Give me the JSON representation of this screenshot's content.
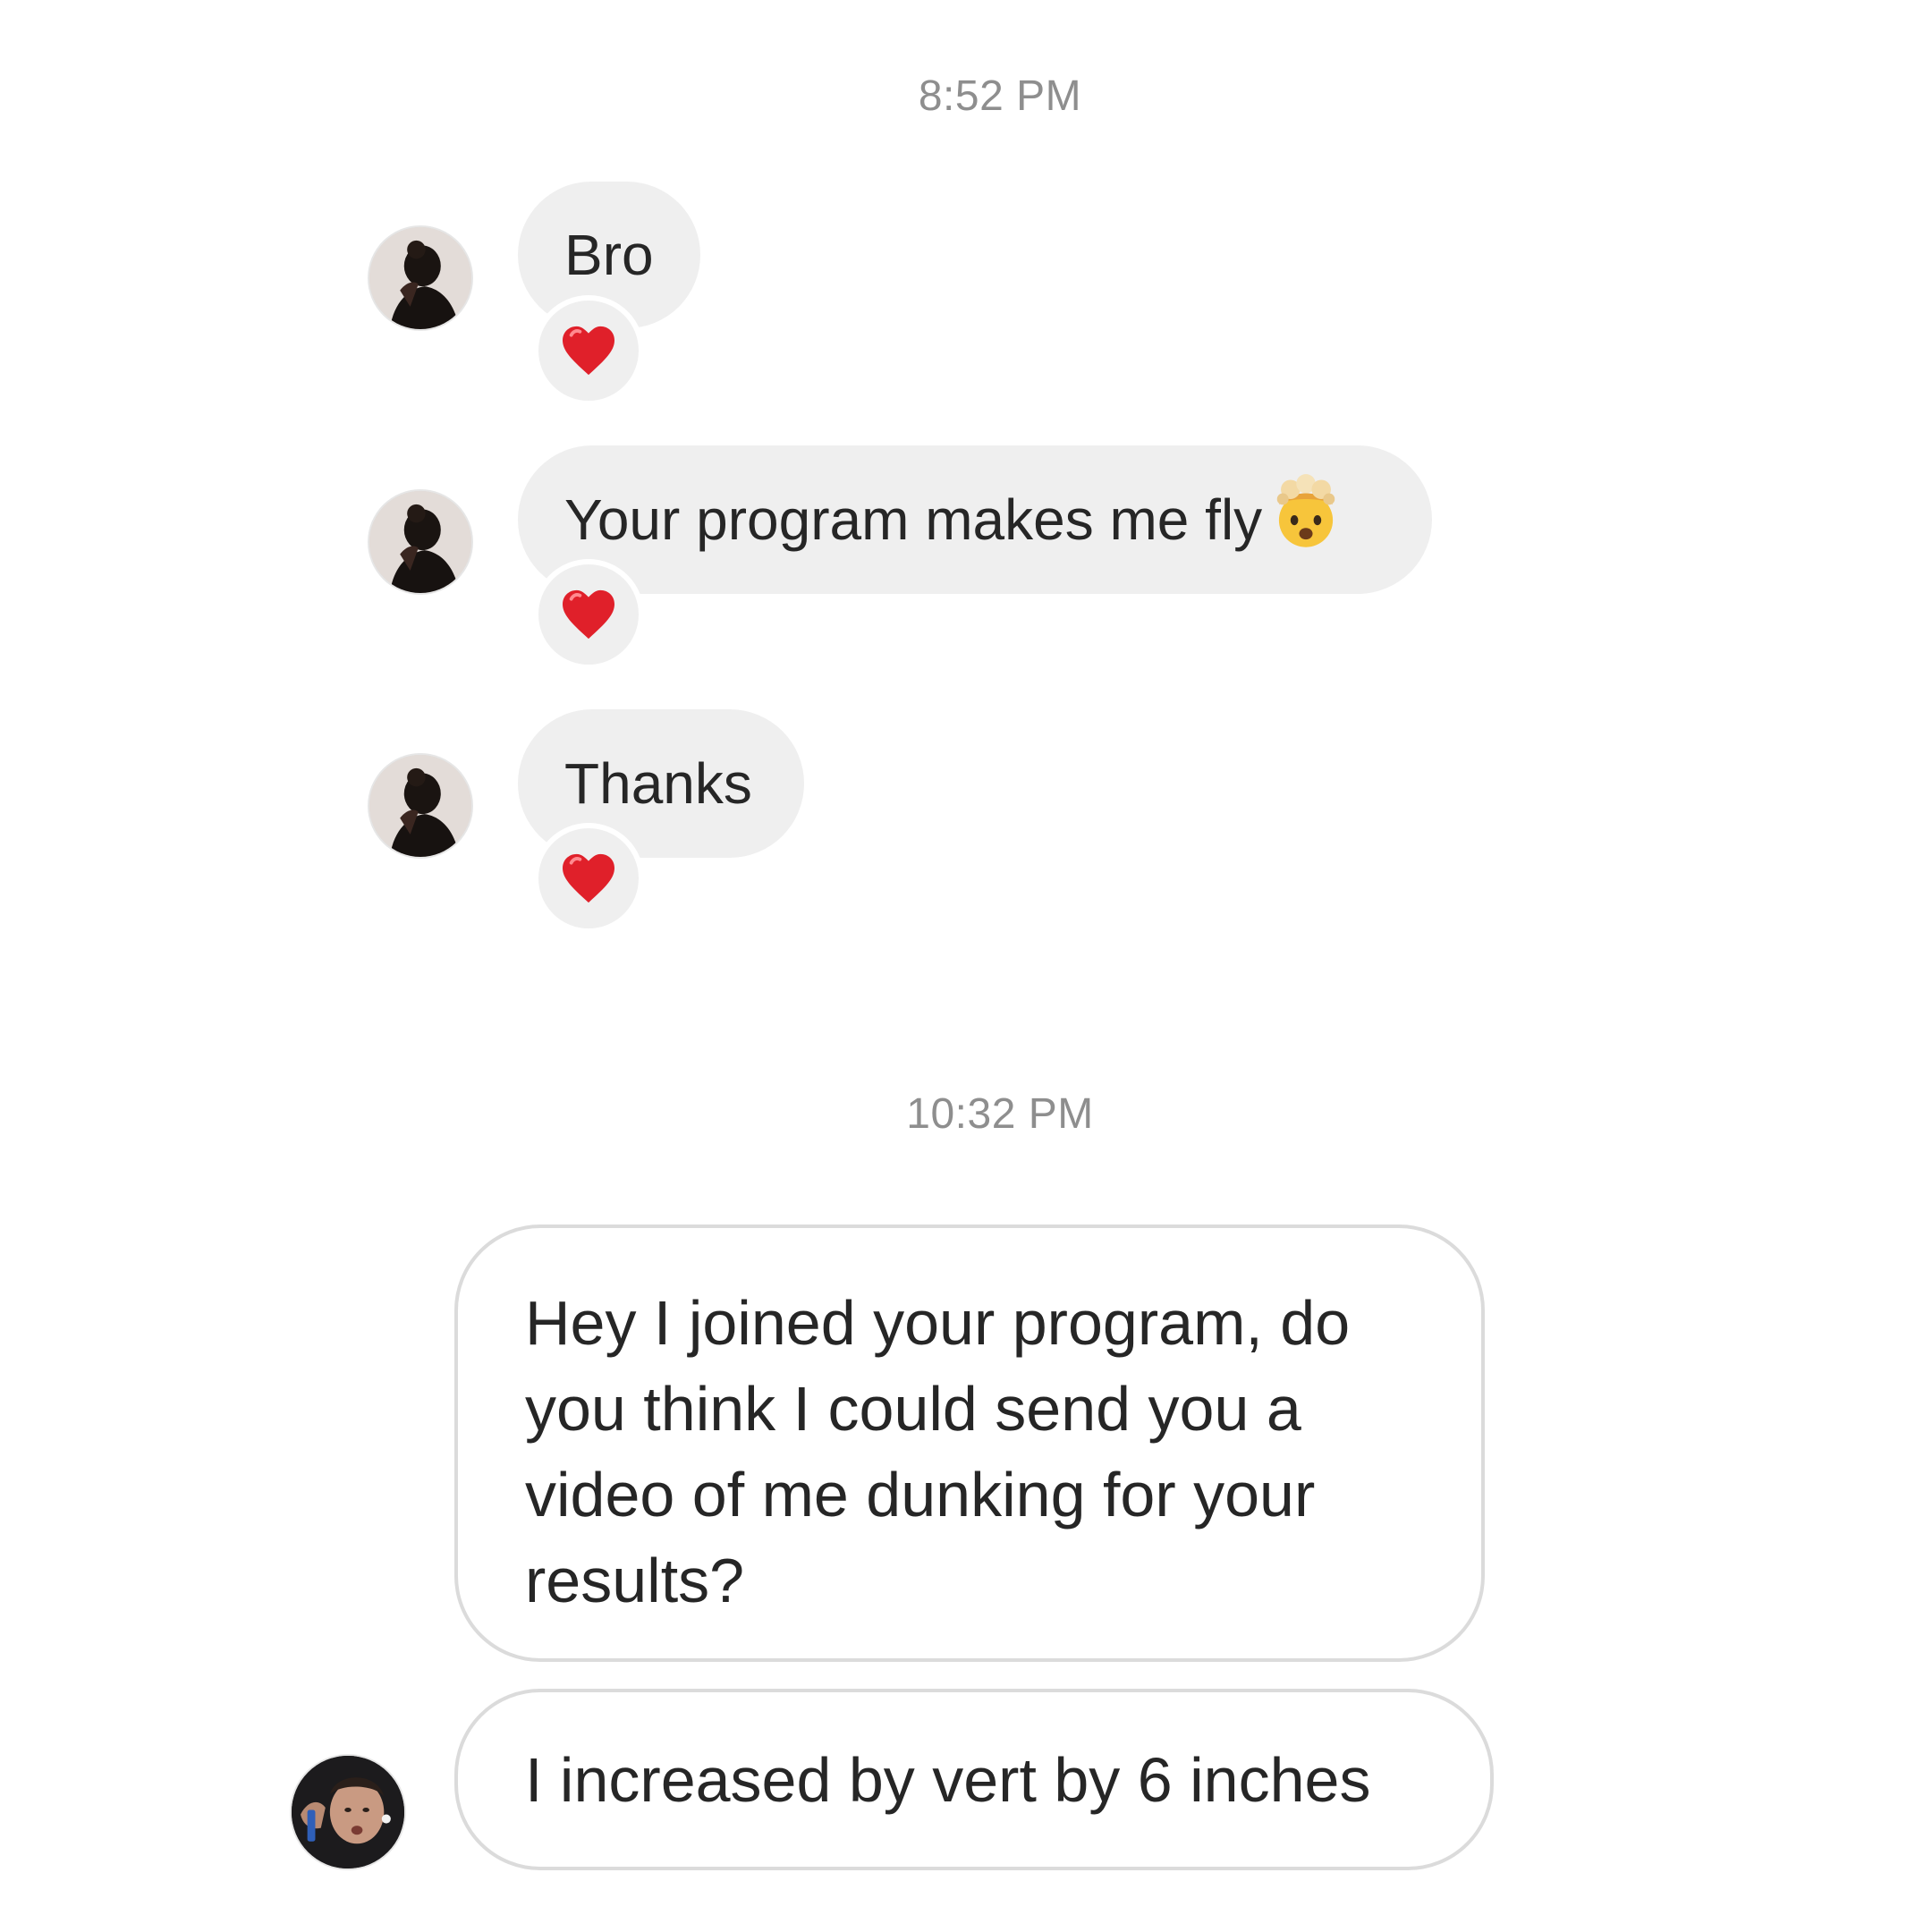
{
  "thread": {
    "timestamps": [
      "8:52 PM",
      "10:32 PM"
    ],
    "incoming": [
      {
        "text": "Bro",
        "reaction": "red-heart"
      },
      {
        "text": "Your program makes me fly",
        "emoji": "exploding-head",
        "reaction": "red-heart"
      },
      {
        "text": "Thanks",
        "reaction": "red-heart"
      }
    ],
    "outgoing": [
      {
        "text": "Hey I joined your program, do you think I could send you a video of me dunking for your results?"
      },
      {
        "text": "I increased by vert by 6 inches"
      }
    ]
  },
  "colors": {
    "incoming_bubble": "#efefef",
    "outgoing_border": "#dbdbdb",
    "timestamp": "#8e8e8e",
    "heart": "#e0202a"
  }
}
